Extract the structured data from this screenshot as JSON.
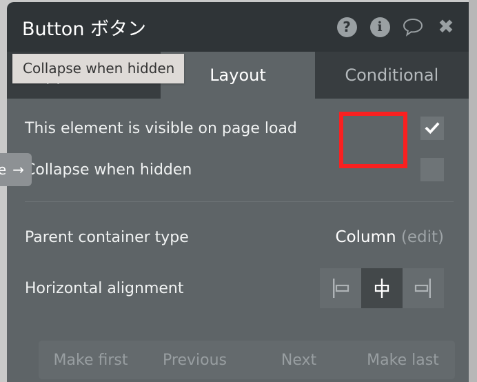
{
  "window": {
    "title": "Button ボタン",
    "header_icons": [
      {
        "name": "help-icon",
        "glyph": "?"
      },
      {
        "name": "info-icon",
        "glyph": "i"
      },
      {
        "name": "comment-icon",
        "glyph": "speech-bubble"
      },
      {
        "name": "close-icon",
        "glyph": "✖"
      }
    ]
  },
  "tooltip": {
    "text": "Collapse when hidden"
  },
  "tabs": [
    {
      "label": "Appearance",
      "active": false
    },
    {
      "label": "Layout",
      "active": true
    },
    {
      "label": "Conditional",
      "active": false
    }
  ],
  "edge_button": {
    "letter": "e",
    "arrow": "→"
  },
  "rows": {
    "visible_on_load": {
      "label": "This element is visible on page load",
      "checked": true
    },
    "collapse_when_hidden": {
      "label": "Collapse when hidden",
      "checked": false
    },
    "parent_container": {
      "label": "Parent container type",
      "value": "Column",
      "edit_link": "(edit)"
    },
    "horizontal_alignment": {
      "label": "Horizontal alignment",
      "options": [
        {
          "name": "align-left",
          "selected": false
        },
        {
          "name": "align-center",
          "selected": true
        },
        {
          "name": "align-right",
          "selected": false
        }
      ]
    }
  },
  "order_buttons": [
    {
      "label": "Make first"
    },
    {
      "label": "Previous"
    },
    {
      "label": "Next"
    },
    {
      "label": "Make last"
    }
  ],
  "colors": {
    "panel_bg": "#5e6467",
    "header_bg": "#2f3437",
    "tab_inactive_bg": "#383d40",
    "tooltip_bg": "#dedad7",
    "highlight_red": "#fa2020",
    "checkbox_bg": "#6e7477",
    "selected_align_bg": "#43484a",
    "outer_bg": "#c9c9c9"
  }
}
